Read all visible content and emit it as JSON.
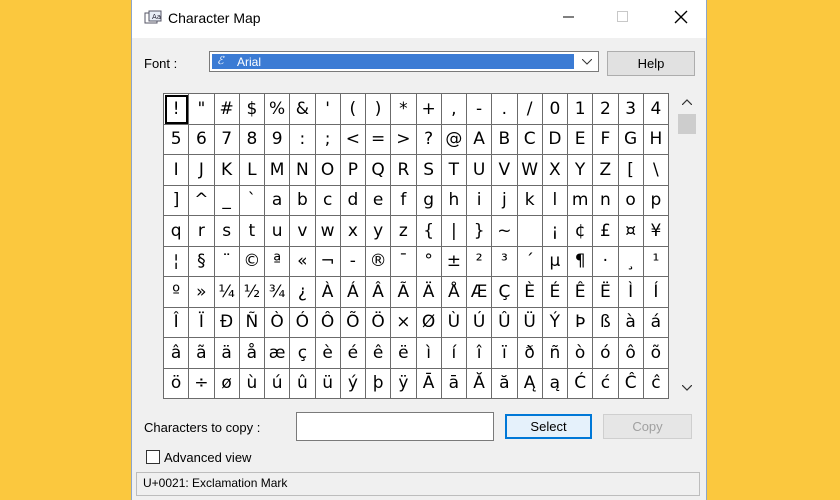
{
  "window": {
    "title": "Character Map",
    "icon": "charmap-app-icon",
    "controls": [
      "minimize-icon",
      "maximize-icon",
      "close-icon"
    ]
  },
  "font": {
    "label": "Font :",
    "value": "Arial",
    "icon": "opentype-font-icon"
  },
  "help_label": "Help",
  "grid": {
    "selected_index": 0,
    "characters": [
      "!",
      "\"",
      "#",
      "$",
      "%",
      "&",
      "'",
      "(",
      ")",
      "*",
      "+",
      ",",
      "-",
      ".",
      "/",
      "0",
      "1",
      "2",
      "3",
      "4",
      "5",
      "6",
      "7",
      "8",
      "9",
      ":",
      ";",
      "<",
      "=",
      ">",
      "?",
      "@",
      "A",
      "B",
      "C",
      "D",
      "E",
      "F",
      "G",
      "H",
      "I",
      "J",
      "K",
      "L",
      "M",
      "N",
      "O",
      "P",
      "Q",
      "R",
      "S",
      "T",
      "U",
      "V",
      "W",
      "X",
      "Y",
      "Z",
      "[",
      "\\",
      "]",
      "^",
      "_",
      "`",
      "a",
      "b",
      "c",
      "d",
      "e",
      "f",
      "g",
      "h",
      "i",
      "j",
      "k",
      "l",
      "m",
      "n",
      "o",
      "p",
      "q",
      "r",
      "s",
      "t",
      "u",
      "v",
      "w",
      "x",
      "y",
      "z",
      "{",
      "|",
      "}",
      "~",
      "",
      "¡",
      "¢",
      "£",
      "¤",
      "¥",
      "¦",
      "§",
      "¨",
      "©",
      "ª",
      "«",
      "¬",
      "-",
      "®",
      "¯",
      "°",
      "±",
      "²",
      "³",
      "´",
      "µ",
      "¶",
      "·",
      "¸",
      "¹",
      "º",
      "»",
      "¼",
      "½",
      "¾",
      "¿",
      "À",
      "Á",
      "Â",
      "Ã",
      "Ä",
      "Å",
      "Æ",
      "Ç",
      "È",
      "É",
      "Ê",
      "Ë",
      "Ì",
      "Í",
      "Î",
      "Ï",
      "Ð",
      "Ñ",
      "Ò",
      "Ó",
      "Ô",
      "Õ",
      "Ö",
      "×",
      "Ø",
      "Ù",
      "Ú",
      "Û",
      "Ü",
      "Ý",
      "Þ",
      "ß",
      "à",
      "á",
      "â",
      "ã",
      "ä",
      "å",
      "æ",
      "ç",
      "è",
      "é",
      "ê",
      "ë",
      "ì",
      "í",
      "î",
      "ï",
      "ð",
      "ñ",
      "ò",
      "ó",
      "ô",
      "õ",
      "ö",
      "÷",
      "ø",
      "ù",
      "ú",
      "û",
      "ü",
      "ý",
      "þ",
      "ÿ",
      "Ā",
      "ā",
      "Ă",
      "ă",
      "Ą",
      "ą",
      "Ć",
      "ć",
      "Ĉ",
      "ĉ"
    ]
  },
  "scrollbar": {
    "up_icon": "scroll-up-icon",
    "down_icon": "scroll-down-icon"
  },
  "copy": {
    "label": "Characters to copy :",
    "value": "",
    "select_label": "Select",
    "copy_label": "Copy"
  },
  "advanced": {
    "label": "Advanced view",
    "checked": false
  },
  "status": {
    "text": "U+0021: Exclamation Mark"
  },
  "colors": {
    "background": "#fbc83e",
    "selection": "#3b7bd4",
    "select_border": "#0078d7"
  }
}
